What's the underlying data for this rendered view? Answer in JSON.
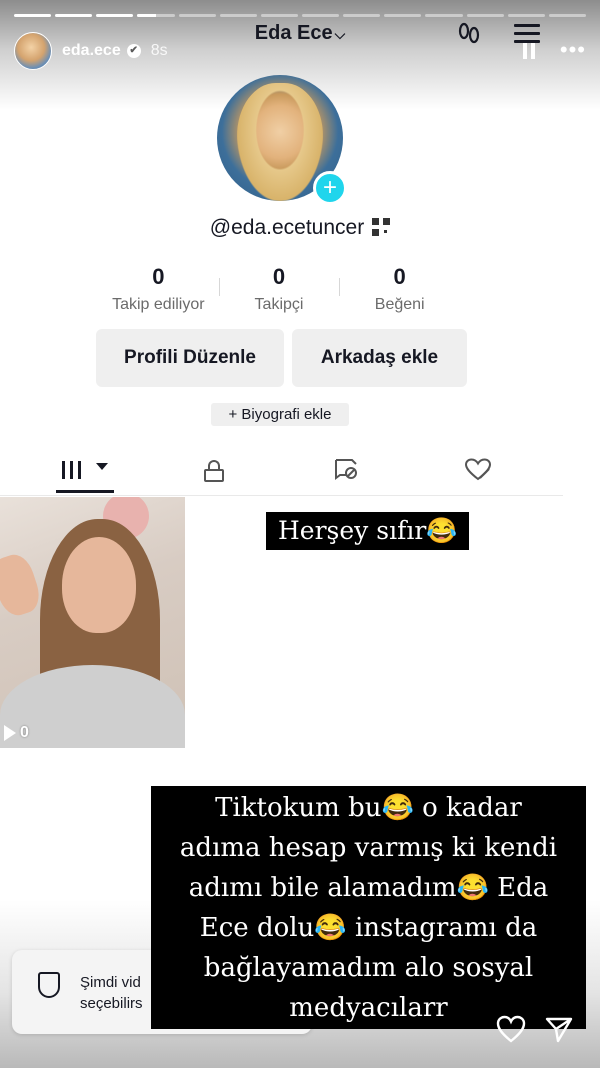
{
  "story": {
    "username": "eda.ece",
    "time": "8s",
    "progress_segments": [
      1,
      1,
      1,
      0.5,
      0,
      0,
      0,
      0,
      0,
      0,
      0,
      0,
      0,
      0
    ]
  },
  "header": {
    "title": "Eda Ece"
  },
  "profile": {
    "handle": "@eda.ecetuncer",
    "stats": [
      {
        "value": "0",
        "label": "Takip ediliyor"
      },
      {
        "value": "0",
        "label": "Takipçi"
      },
      {
        "value": "0",
        "label": "Beğeni"
      }
    ],
    "edit_button": "Profili Düzenle",
    "add_friend_button": "Arkadaş ekle",
    "bio_button": "+ Biyografi ekle"
  },
  "video": {
    "views": "0"
  },
  "captions": {
    "first": "Herşey sıfır😂",
    "second_lines": [
      "Tiktokum bu😂 o kadar",
      "adıma hesap varmış ki kendi",
      "adımı bile alamadım😂 Eda",
      "Ece dolu😂  instagramı da",
      "bağlayamadım alo sosyal",
      "medyacılarr"
    ]
  },
  "toast": {
    "line1": "Şimdi vid",
    "line2": "seçebilirs"
  },
  "colors": {
    "accent": "#20d5ec",
    "text": "#161823",
    "button_bg": "#efefef"
  }
}
